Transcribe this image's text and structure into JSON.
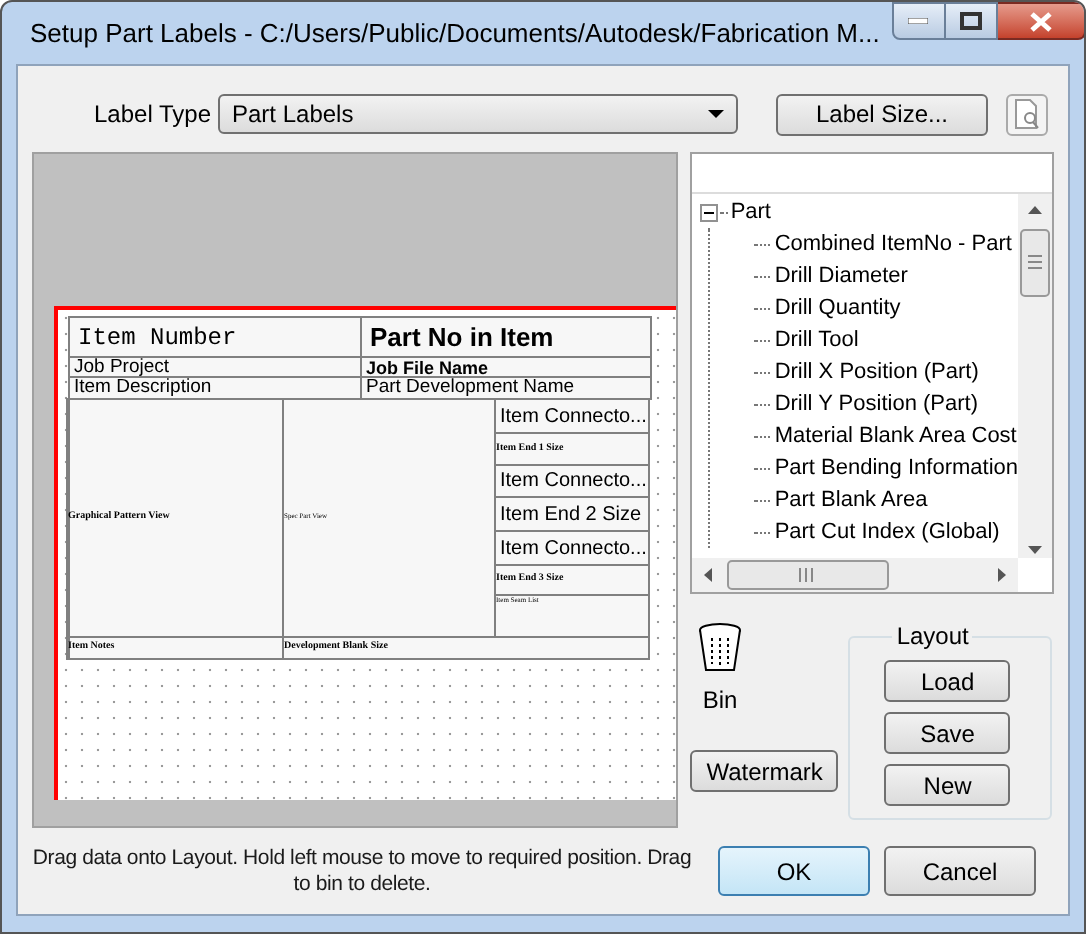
{
  "window": {
    "title": "Setup Part Labels - C:/Users/Public/Documents/Autodesk/Fabrication M..."
  },
  "label_type": {
    "label": "Label Type",
    "value": "Part Labels"
  },
  "label_size_button": "Label Size...",
  "label_layout": {
    "cells": [
      {
        "text": "Item Number",
        "kind": "serif-large"
      },
      {
        "text": "Part No in Item",
        "kind": "bold-large"
      },
      {
        "text": "Job Project",
        "kind": "normal"
      },
      {
        "text": "Job File Name",
        "kind": "bold-small"
      },
      {
        "text": "Item Description",
        "kind": "normal"
      },
      {
        "text": "Part Development Name",
        "kind": "normal"
      }
    ],
    "left_panels": [
      {
        "text": "Graphical Pattern View",
        "kind": "tiny"
      },
      {
        "text": "Spec Part View",
        "kind": "micro"
      }
    ],
    "right_cells": [
      {
        "text": "Item Connecto...",
        "kind": "medium"
      },
      {
        "text": "Item End 1 Size",
        "kind": "tiny"
      },
      {
        "text": "Item Connecto...",
        "kind": "medium"
      },
      {
        "text": "Item End 2 Size",
        "kind": "medium"
      },
      {
        "text": "Item Connecto...",
        "kind": "medium"
      },
      {
        "text": "Item End 3 Size",
        "kind": "tiny"
      },
      {
        "text": "Item Seam List",
        "kind": "micro"
      }
    ],
    "footer_cells": [
      {
        "text": "Item Notes",
        "kind": "tiny"
      },
      {
        "text": "Development Blank Size",
        "kind": "tiny"
      }
    ]
  },
  "tree": {
    "root": {
      "label": "Part",
      "expanded": true,
      "children": [
        {
          "label": "Combined ItemNo - Part"
        },
        {
          "label": "Drill Diameter"
        },
        {
          "label": "Drill Quantity"
        },
        {
          "label": "Drill Tool"
        },
        {
          "label": "Drill X Position (Part)"
        },
        {
          "label": "Drill Y Position (Part)"
        },
        {
          "label": "Material Blank Area Cost"
        },
        {
          "label": "Part Bending Information"
        },
        {
          "label": "Part Blank Area"
        },
        {
          "label": "Part Cut Index (Global)"
        }
      ]
    }
  },
  "bin": {
    "label": "Bin"
  },
  "watermark_button": "Watermark",
  "layout_group": {
    "title": "Layout",
    "buttons": [
      "Load",
      "Save",
      "New"
    ]
  },
  "hint": "Drag data onto Layout. Hold left mouse to move to required position. Drag to bin to delete.",
  "ok_button": "OK",
  "cancel_button": "Cancel"
}
